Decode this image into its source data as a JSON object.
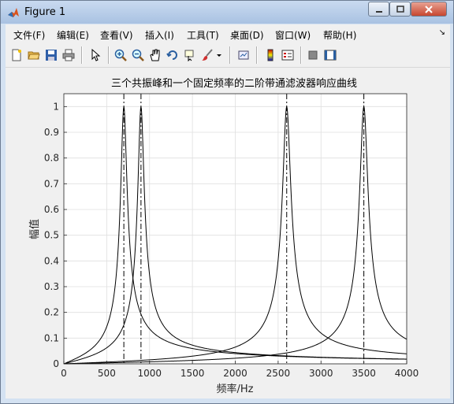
{
  "window": {
    "title": "Figure 1"
  },
  "menu": [
    {
      "label": "文件(F)"
    },
    {
      "label": "编辑(E)"
    },
    {
      "label": "查看(V)"
    },
    {
      "label": "插入(I)"
    },
    {
      "label": "工具(T)"
    },
    {
      "label": "桌面(D)"
    },
    {
      "label": "窗口(W)"
    },
    {
      "label": "帮助(H)"
    }
  ],
  "chart_data": {
    "type": "line",
    "title": "三个共振峰和一个固定频率的二阶带通滤波器响应曲线",
    "xlabel": "频率/Hz",
    "ylabel": "幅值",
    "xlim": [
      0,
      4000
    ],
    "ylim": [
      0,
      1.05
    ],
    "xticks": [
      0,
      500,
      1000,
      1500,
      2000,
      2500,
      3000,
      3500,
      4000
    ],
    "yticks": [
      0,
      0.1,
      0.2,
      0.3,
      0.4,
      0.5,
      0.6,
      0.7,
      0.8,
      0.9,
      1
    ],
    "grid": true,
    "series": [
      {
        "center_hz": 700,
        "bandwidth_hz": 70
      },
      {
        "center_hz": 900,
        "bandwidth_hz": 70
      },
      {
        "center_hz": 2600,
        "bandwidth_hz": 90
      },
      {
        "center_hz": 3500,
        "bandwidth_hz": 90
      }
    ],
    "vlines_hz": [
      700,
      900,
      2600,
      3500
    ]
  }
}
